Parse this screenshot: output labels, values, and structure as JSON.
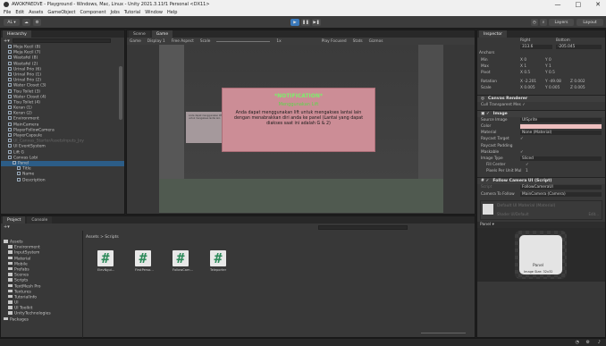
{
  "titlebar": {
    "title": "AWOKFAEDVE - Playground - Windows, Mac, Linux - Unity 2021.3.11f1 Personal <DX11>",
    "min": "—",
    "max": "□",
    "close": "✕"
  },
  "menu": [
    "File",
    "Edit",
    "Assets",
    "GameObject",
    "Component",
    "Jobs",
    "Tutorial",
    "Window",
    "Help"
  ],
  "toolbar": {
    "account": "AL ▾",
    "layers": "Layers",
    "layout": "Layout"
  },
  "hierarchy": {
    "tab": "Hierarchy",
    "items": [
      {
        "label": "Meja Kecil (8)",
        "indent": 1,
        "state": "normal"
      },
      {
        "label": "Meja Kecil (7)",
        "indent": 1,
        "state": "normal"
      },
      {
        "label": "Wastafel (8)",
        "indent": 1,
        "state": "normal"
      },
      {
        "label": "Wastafel (2)",
        "indent": 1,
        "state": "normal"
      },
      {
        "label": "Urinal Prio (6)",
        "indent": 1,
        "state": "normal"
      },
      {
        "label": "Urinal Prio (1)",
        "indent": 1,
        "state": "normal"
      },
      {
        "label": "Urinal Prio (2)",
        "indent": 1,
        "state": "normal"
      },
      {
        "label": "Water Closet (3)",
        "indent": 1,
        "state": "normal"
      },
      {
        "label": "Tisu Toilet (3)",
        "indent": 1,
        "state": "normal"
      },
      {
        "label": "Water Closet (4)",
        "indent": 1,
        "state": "normal"
      },
      {
        "label": "Tisu Toilet (4)",
        "indent": 1,
        "state": "normal"
      },
      {
        "label": "Keran (1)",
        "indent": 1,
        "state": "normal"
      },
      {
        "label": "Keran (2)",
        "indent": 1,
        "state": "normal"
      },
      {
        "label": "Environment",
        "indent": 1,
        "state": "normal"
      },
      {
        "label": "MainCamera",
        "indent": 1,
        "state": "normal"
      },
      {
        "label": "PlayerFollowCamera",
        "indent": 1,
        "state": "normal"
      },
      {
        "label": "PlayerCapsule",
        "indent": 1,
        "state": "normal"
      },
      {
        "label": "UI_Canvas_StarterAssetsInputs_Joy",
        "indent": 1,
        "state": "dim"
      },
      {
        "label": "UI EventSystem",
        "indent": 1,
        "state": "normal"
      },
      {
        "label": "Lift G",
        "indent": 1,
        "state": "normal"
      },
      {
        "label": "Canvas Lobi",
        "indent": 1,
        "state": "normal"
      },
      {
        "label": "Panel",
        "indent": 2,
        "state": "selected"
      },
      {
        "label": "Title",
        "indent": 3,
        "state": "normal"
      },
      {
        "label": "Name",
        "indent": 3,
        "state": "normal"
      },
      {
        "label": "Description",
        "indent": 3,
        "state": "normal"
      }
    ]
  },
  "sceneview": {
    "tabs": [
      "Scene",
      "Game"
    ],
    "game_opts": [
      "Game",
      "Display 1",
      "Free Aspect",
      "Scale",
      "1x",
      "Play Focused",
      "Stats",
      "Gizmos"
    ]
  },
  "notification": {
    "title": "*NOTIFICATION*",
    "subtitle": "Menggunakan Lift",
    "body": "Anda dapat menggunakan lift untuk mengakses lantai lain dengan menabrakkan diri anda ke panel (Lantai yang dapat diakses saat ini adalah G & 2)",
    "small": "Anda dapat menggunakan lift untuk mengakses lantai lain"
  },
  "project": {
    "tabs": [
      "Project",
      "Console"
    ],
    "breadcrumb": "Assets > Scripts",
    "tree": [
      {
        "label": "Assets",
        "indent": 0
      },
      {
        "label": "Environment",
        "indent": 1
      },
      {
        "label": "InputSystem",
        "indent": 1
      },
      {
        "label": "Material",
        "indent": 1
      },
      {
        "label": "Mobile",
        "indent": 1
      },
      {
        "label": "Prefabs",
        "indent": 1
      },
      {
        "label": "Scenes",
        "indent": 1
      },
      {
        "label": "Scripts",
        "indent": 1
      },
      {
        "label": "TextMesh Pro",
        "indent": 1
      },
      {
        "label": "Textures",
        "indent": 1
      },
      {
        "label": "TutorialInfo",
        "indent": 1
      },
      {
        "label": "UI",
        "indent": 1
      },
      {
        "label": "UI Toolkit",
        "indent": 1
      },
      {
        "label": "UnityTechnologies",
        "indent": 1
      },
      {
        "label": "Packages",
        "indent": 0
      }
    ],
    "scripts": [
      "ElevNgui...",
      "FirstPerso...",
      "FollowCam...",
      "Teleporter"
    ]
  },
  "inspector": {
    "tab": "Inspector",
    "rect": {
      "right_lbl": "Right",
      "bottom_lbl": "Bottom",
      "right": "313.6",
      "bottom": "-205.045"
    },
    "anchors": {
      "header": "Anchors",
      "min": "Min",
      "max": "Max",
      "pivot": "Pivot",
      "min_x": "0",
      "min_y": "0",
      "max_x": "1",
      "max_y": "1",
      "pivot_x": "0.5",
      "pivot_y": "0.5"
    },
    "rotation": {
      "label": "Rotation",
      "x": "-2.201",
      "y": "-49.08",
      "z": "0.002"
    },
    "scale": {
      "label": "Scale",
      "x": "0.005",
      "y": "0.005",
      "z": "0.005"
    },
    "canvas_renderer": {
      "title": "Canvas Renderer",
      "cull": "Cull Transparent Mes ✓"
    },
    "image": {
      "title": "Image",
      "source_lbl": "Source Image",
      "source": "UISprite",
      "color_lbl": "Color",
      "material_lbl": "Material",
      "material": "None (Material)",
      "raycast_lbl": "Raycast Target",
      "padding_lbl": "Raycast Padding",
      "maskable_lbl": "Maskable",
      "type_lbl": "Image Type",
      "type": "Sliced",
      "fill_lbl": "Fill Center",
      "ppu_lbl": "Pixels Per Unit Mul",
      "ppu": "1"
    },
    "follow": {
      "title": "Follow Camera UI (Script)",
      "script_lbl": "Script",
      "script": "FollowCameraUI",
      "cam_lbl": "Camera To Follow",
      "cam": "MainCamera (Camera)"
    },
    "material": {
      "title": "Default UI Material (Material)",
      "shader_lbl": "Shader",
      "shader": "UI/Default",
      "edit": "Edit..."
    },
    "preview": {
      "header": "Panel ▾",
      "label": "Panel",
      "size": "Image Size: 32x32"
    },
    "panel_color": "#eebfbf"
  }
}
